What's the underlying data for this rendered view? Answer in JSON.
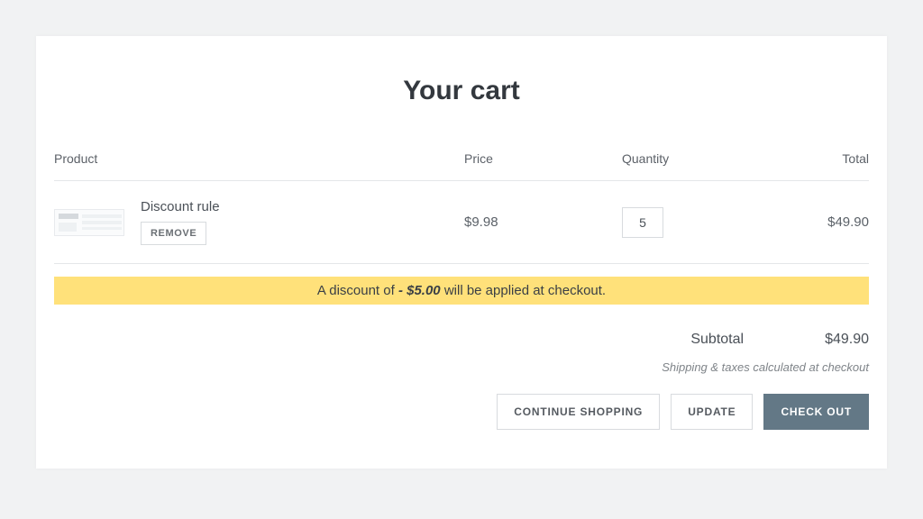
{
  "title": "Your cart",
  "headers": {
    "product": "Product",
    "price": "Price",
    "quantity": "Quantity",
    "total": "Total"
  },
  "item": {
    "name": "Discount rule",
    "remove_label": "REMOVE",
    "price": "$9.98",
    "quantity": "5",
    "total": "$49.90"
  },
  "banner": {
    "prefix": "A discount of ",
    "amount": "- $5.00",
    "suffix": " will be applied at checkout."
  },
  "subtotal": {
    "label": "Subtotal",
    "value": "$49.90"
  },
  "note": "Shipping & taxes calculated at checkout",
  "actions": {
    "continue": "CONTINUE SHOPPING",
    "update": "UPDATE",
    "checkout": "CHECK OUT"
  }
}
